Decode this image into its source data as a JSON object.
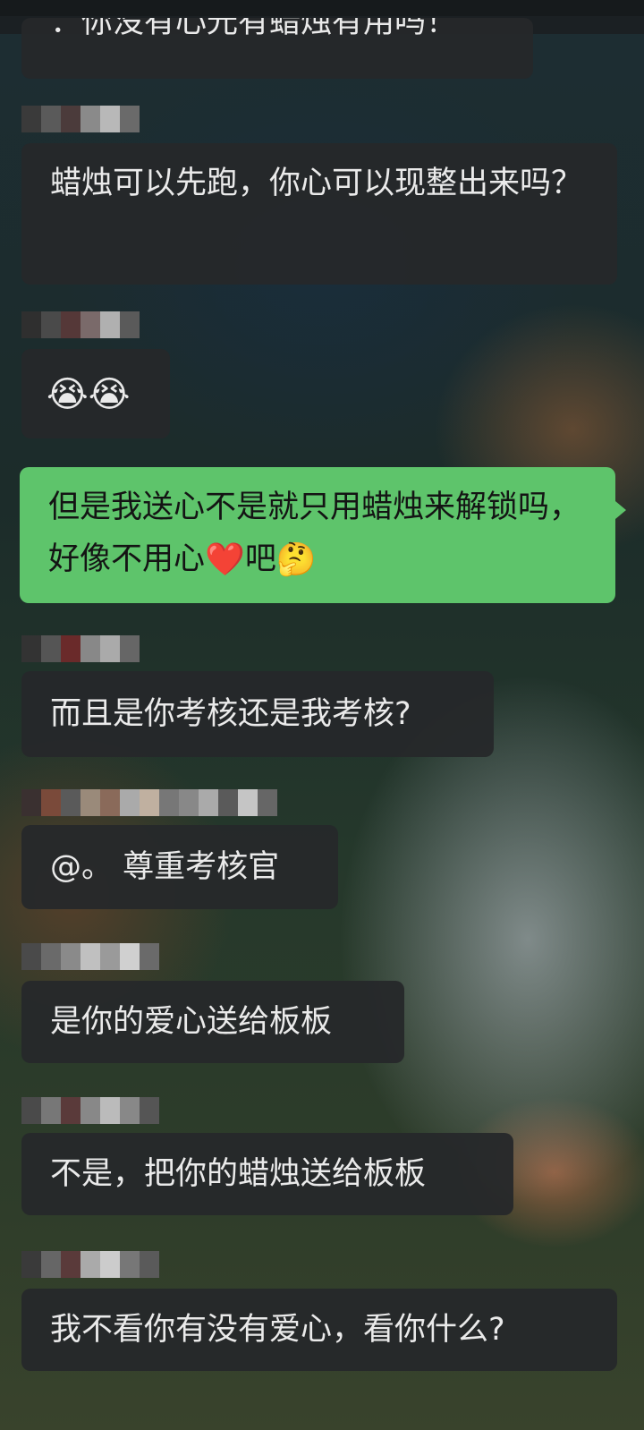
{
  "chat": {
    "messages": [
      {
        "id": "m0",
        "side": "left",
        "text": "：你没有心光有蜡烛有用吗！",
        "partial": true
      },
      {
        "id": "m1",
        "side": "left",
        "text": "蜡烛可以先跑，你心可以现整出来吗？"
      },
      {
        "id": "m2",
        "side": "left",
        "emoji": "😭😭",
        "emoji_names": [
          "crying-face-icon",
          "crying-face-icon"
        ]
      },
      {
        "id": "m3",
        "side": "right",
        "text_before": "但是我送心不是就只用蜡烛来解锁吗，好像不用心",
        "heart": "❤️",
        "text_after": "吧",
        "thinking": "🤔"
      },
      {
        "id": "m4",
        "side": "left",
        "text": "而且是你考核还是我考核?"
      },
      {
        "id": "m5",
        "side": "left",
        "text": "@。 尊重考核官"
      },
      {
        "id": "m6",
        "side": "left",
        "text": "是你的爱心送给板板"
      },
      {
        "id": "m7",
        "side": "left",
        "text": "不是，把你的蜡烛送给板板"
      },
      {
        "id": "m8",
        "side": "left",
        "text": "我不看你有没有爱心，看你什么?"
      }
    ]
  },
  "colors": {
    "self_bubble": "#5ec46b",
    "other_bubble": "#26282a",
    "text_light": "#eaeaea",
    "text_dark": "#141414"
  }
}
